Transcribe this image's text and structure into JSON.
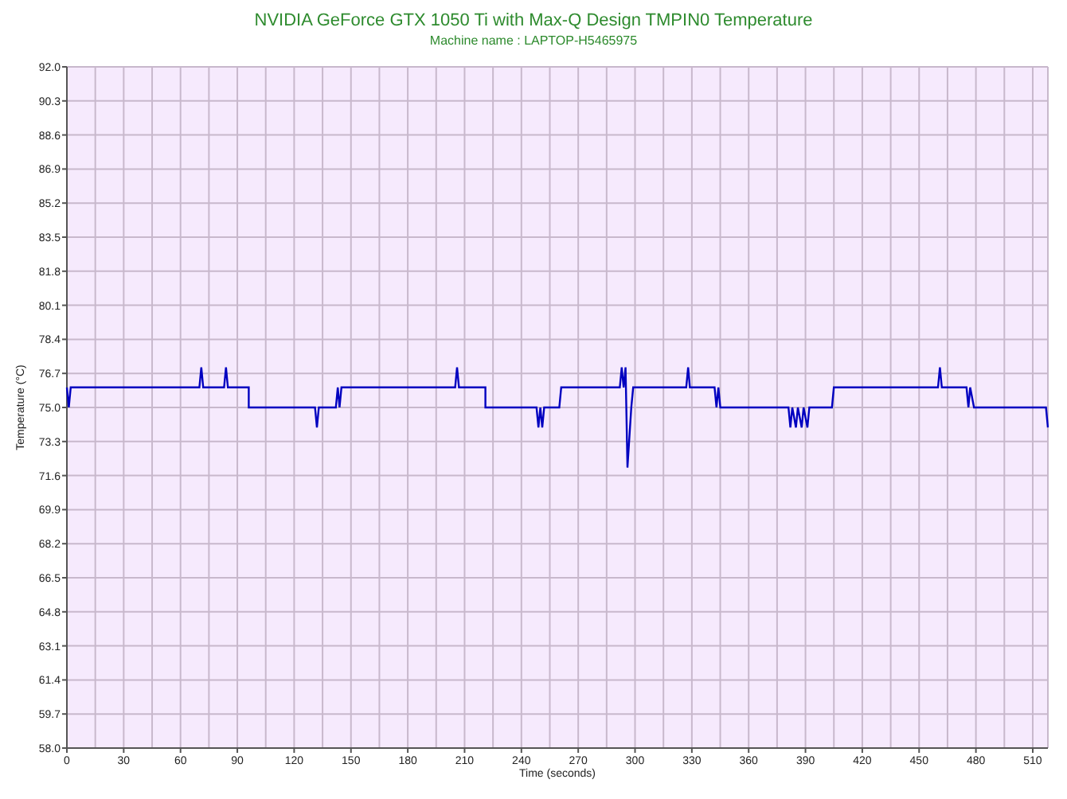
{
  "chart_data": {
    "type": "line",
    "title": "NVIDIA GeForce GTX 1050 Ti with Max-Q Design TMPIN0 Temperature",
    "subtitle": "Machine name : LAPTOP-H5465975",
    "xlabel": "Time (seconds)",
    "ylabel": "Temperature (°C)",
    "x": [
      0,
      1,
      2,
      70,
      71,
      72,
      83,
      84,
      85,
      96,
      96,
      131,
      132,
      133,
      142,
      143,
      144,
      145,
      205,
      206,
      207,
      221,
      221,
      248,
      249,
      250,
      251,
      252,
      260,
      261,
      292,
      293,
      294,
      295,
      296,
      298,
      299,
      327,
      328,
      329,
      342,
      343,
      344,
      345,
      381,
      382,
      383,
      385,
      386,
      388,
      389,
      391,
      392,
      404,
      405,
      460,
      461,
      462,
      475,
      476,
      477,
      479,
      517,
      518
    ],
    "series": [
      {
        "color": "#0000c0",
        "values": [
          76,
          75,
          76,
          76,
          77,
          76,
          76,
          77,
          76,
          76,
          75,
          75,
          74,
          75,
          75,
          76,
          75,
          76,
          76,
          77,
          76,
          76,
          75,
          75,
          74,
          75,
          74,
          75,
          75,
          76,
          76,
          77,
          76,
          77,
          72,
          75,
          76,
          76,
          77,
          76,
          76,
          75,
          76,
          75,
          75,
          74,
          75,
          74,
          75,
          74,
          75,
          74,
          75,
          75,
          76,
          76,
          77,
          76,
          76,
          75,
          76,
          75,
          75,
          74
        ]
      }
    ],
    "grid": true,
    "xlim": [
      0,
      518
    ],
    "ylim": [
      58,
      92
    ],
    "xticks": [
      0,
      30,
      60,
      90,
      120,
      150,
      180,
      210,
      240,
      270,
      300,
      330,
      360,
      390,
      420,
      450,
      480,
      510
    ],
    "yticks": [
      {
        "value": 92,
        "label": "92.0"
      },
      {
        "value": 90.3,
        "label": "90.3"
      },
      {
        "value": 88.6,
        "label": "88.6"
      },
      {
        "value": 86.9,
        "label": "86.9"
      },
      {
        "value": 85.2,
        "label": "85.2"
      },
      {
        "value": 83.5,
        "label": "83.5"
      },
      {
        "value": 81.8,
        "label": "81.8"
      },
      {
        "value": 80.1,
        "label": "80.1"
      },
      {
        "value": 78.4,
        "label": "78.4"
      },
      {
        "value": 76.7,
        "label": "76.7"
      },
      {
        "value": 75,
        "label": "75.0"
      },
      {
        "value": 73.3,
        "label": "73.3"
      },
      {
        "value": 71.6,
        "label": "71.6"
      },
      {
        "value": 69.9,
        "label": "69.9"
      },
      {
        "value": 68.2,
        "label": "68.2"
      },
      {
        "value": 66.5,
        "label": "66.5"
      },
      {
        "value": 64.8,
        "label": "64.8"
      },
      {
        "value": 63.1,
        "label": "63.1"
      },
      {
        "value": 61.4,
        "label": "61.4"
      },
      {
        "value": 59.7,
        "label": "59.7"
      },
      {
        "value": 58,
        "label": "58.0"
      }
    ]
  }
}
